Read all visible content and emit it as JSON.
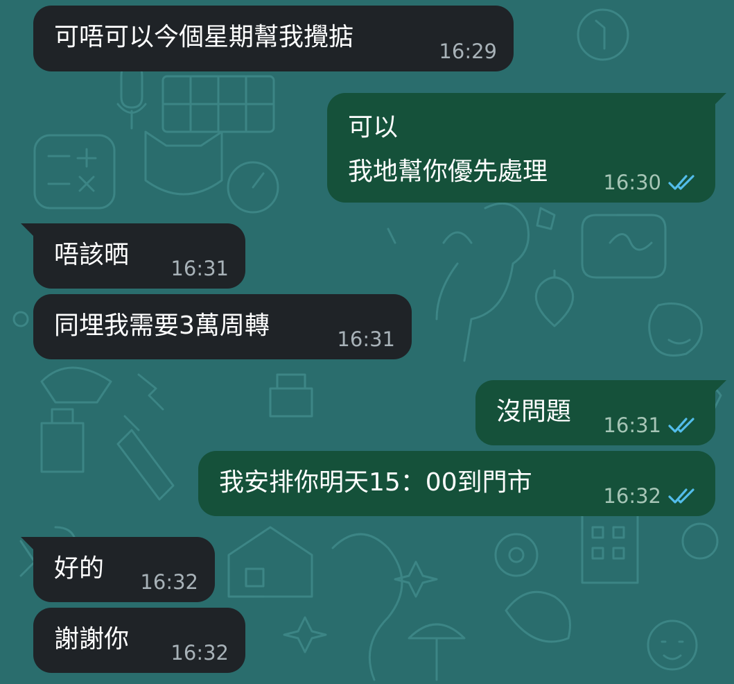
{
  "colors": {
    "wallpaper": "#2a6d6d",
    "incoming_bubble": "#1f2327",
    "outgoing_bubble": "#15513a",
    "read_check": "#53bdeb"
  },
  "messages": [
    {
      "direction": "incoming",
      "lines": [
        "可唔可以今個星期幫我攪掂"
      ],
      "time": "16:29"
    },
    {
      "direction": "outgoing",
      "lines": [
        "可以",
        "我地幫你優先處理"
      ],
      "time": "16:30",
      "status": "read"
    },
    {
      "direction": "incoming",
      "lines": [
        "唔該晒"
      ],
      "time": "16:31"
    },
    {
      "direction": "incoming",
      "lines": [
        "同埋我需要3萬周轉"
      ],
      "time": "16:31"
    },
    {
      "direction": "outgoing",
      "lines": [
        "沒問題"
      ],
      "time": "16:31",
      "status": "read"
    },
    {
      "direction": "outgoing",
      "lines": [
        "我安排你明天15：00到門市"
      ],
      "time": "16:32",
      "status": "read"
    },
    {
      "direction": "incoming",
      "lines": [
        "好的"
      ],
      "time": "16:32"
    },
    {
      "direction": "incoming",
      "lines": [
        "謝謝你"
      ],
      "time": "16:32"
    }
  ],
  "icons": {
    "read_receipt": "double-check-icon"
  }
}
